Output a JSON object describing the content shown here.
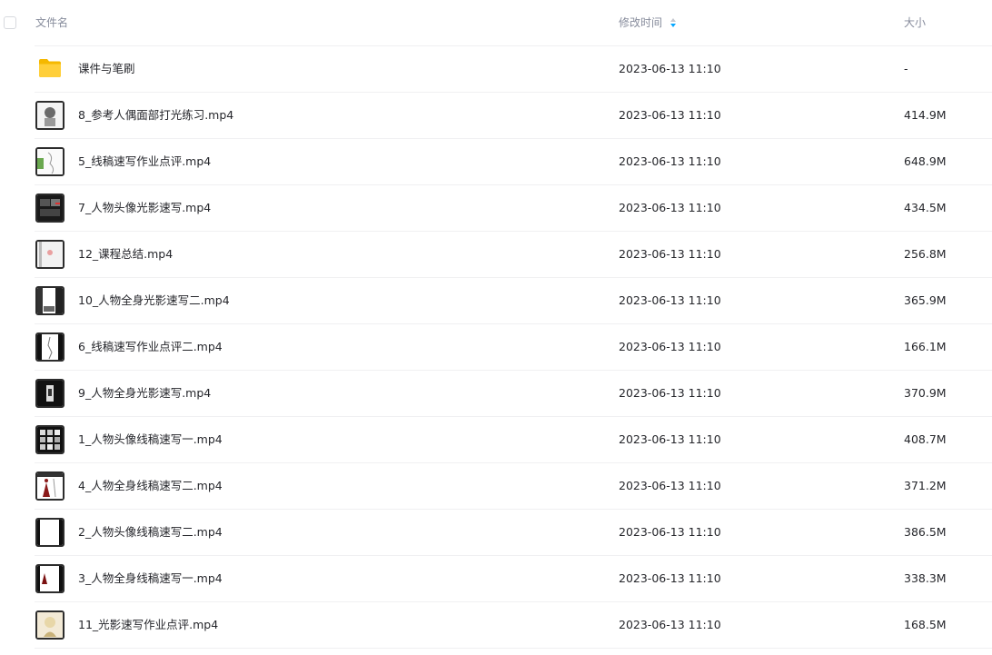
{
  "columns": {
    "name": "文件名",
    "modified": "修改时间",
    "size": "大小"
  },
  "colors": {
    "sort_accent": "#06a7ff",
    "folder": "#ffcf3a"
  },
  "files": [
    {
      "name": "课件与笔刷",
      "modified": "2023-06-13 11:10",
      "size": "-",
      "icon": "folder-icon"
    },
    {
      "name": "8_参考人偶面部打光练习.mp4",
      "modified": "2023-06-13 11:10",
      "size": "414.9M",
      "icon": "video-thumbnail"
    },
    {
      "name": "5_线稿速写作业点评.mp4",
      "modified": "2023-06-13 11:10",
      "size": "648.9M",
      "icon": "video-thumbnail"
    },
    {
      "name": "7_人物头像光影速写.mp4",
      "modified": "2023-06-13 11:10",
      "size": "434.5M",
      "icon": "video-thumbnail"
    },
    {
      "name": "12_课程总结.mp4",
      "modified": "2023-06-13 11:10",
      "size": "256.8M",
      "icon": "video-thumbnail"
    },
    {
      "name": "10_人物全身光影速写二.mp4",
      "modified": "2023-06-13 11:10",
      "size": "365.9M",
      "icon": "video-thumbnail"
    },
    {
      "name": "6_线稿速写作业点评二.mp4",
      "modified": "2023-06-13 11:10",
      "size": "166.1M",
      "icon": "video-thumbnail"
    },
    {
      "name": "9_人物全身光影速写.mp4",
      "modified": "2023-06-13 11:10",
      "size": "370.9M",
      "icon": "video-thumbnail"
    },
    {
      "name": "1_人物头像线稿速写一.mp4",
      "modified": "2023-06-13 11:10",
      "size": "408.7M",
      "icon": "video-thumbnail"
    },
    {
      "name": "4_人物全身线稿速写二.mp4",
      "modified": "2023-06-13 11:10",
      "size": "371.2M",
      "icon": "video-thumbnail"
    },
    {
      "name": "2_人物头像线稿速写二.mp4",
      "modified": "2023-06-13 11:10",
      "size": "386.5M",
      "icon": "video-thumbnail"
    },
    {
      "name": "3_人物全身线稿速写一.mp4",
      "modified": "2023-06-13 11:10",
      "size": "338.3M",
      "icon": "video-thumbnail"
    },
    {
      "name": "11_光影速写作业点评.mp4",
      "modified": "2023-06-13 11:10",
      "size": "168.5M",
      "icon": "video-thumbnail"
    }
  ]
}
